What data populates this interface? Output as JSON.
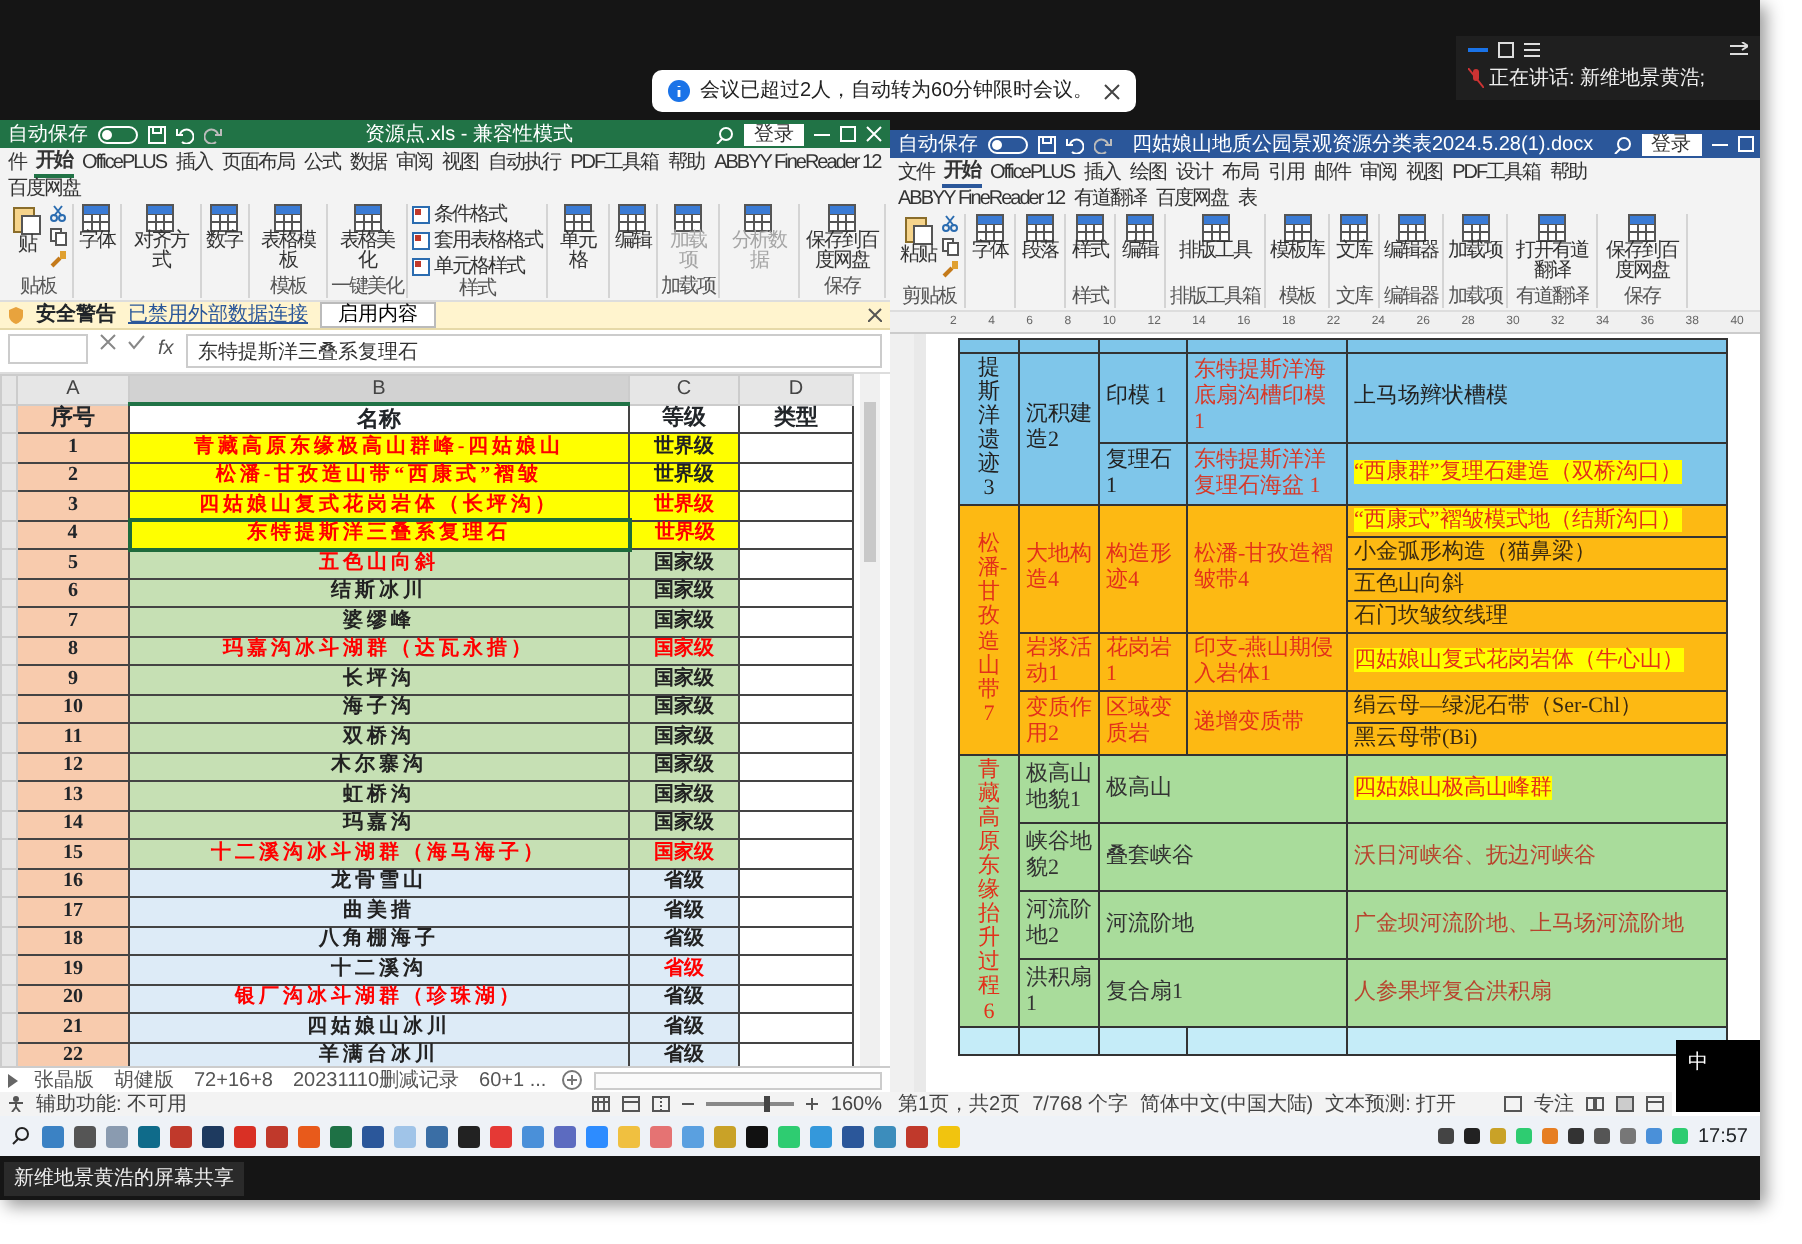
{
  "meeting": {
    "notice": "会议已超过2人，自动转为60分钟限时会议。",
    "speaker_label": "正在讲话:",
    "speaker": "新维地景黄浩;",
    "share_label": "新维地景黄浩的屏幕共享",
    "ime": "中"
  },
  "excel": {
    "autosave": "自动保存",
    "autosave_on": false,
    "title": "资源点.xls - 兼容性模式",
    "signin": "登录",
    "tabs": [
      {
        "label": "件",
        "selected": false
      },
      {
        "label": "开始",
        "selected": true
      },
      {
        "label": "OfficePLUS",
        "selected": false
      },
      {
        "label": "插入",
        "selected": false
      },
      {
        "label": "页面布局",
        "selected": false
      },
      {
        "label": "公式",
        "selected": false
      },
      {
        "label": "数据",
        "selected": false
      },
      {
        "label": "审阅",
        "selected": false
      },
      {
        "label": "视图",
        "selected": false
      },
      {
        "label": "自动执行",
        "selected": false
      },
      {
        "label": "PDF工具箱",
        "selected": false
      },
      {
        "label": "帮助",
        "selected": false
      },
      {
        "label": "ABBYY FineReader 12",
        "selected": false
      },
      {
        "label": "百度网盘",
        "selected": false
      }
    ],
    "ribbon": [
      {
        "label": "贴板",
        "buttons": [
          {
            "label": "贴",
            "kind": "paste",
            "disabled": false
          }
        ]
      },
      {
        "buttons": [
          {
            "label": "字体",
            "kind": "large",
            "disabled": false
          }
        ]
      },
      {
        "buttons": [
          {
            "label": "对齐方式",
            "kind": "large",
            "disabled": false
          }
        ]
      },
      {
        "buttons": [
          {
            "label": "数字",
            "kind": "large",
            "disabled": false
          }
        ]
      },
      {
        "label": "模板",
        "buttons": [
          {
            "label": "表格模板",
            "kind": "large",
            "disabled": false
          }
        ]
      },
      {
        "label": "一键美化",
        "buttons": [
          {
            "label": "表格美化",
            "kind": "large",
            "disabled": false
          }
        ]
      },
      {
        "label": "样式",
        "buttons": [
          {
            "label": "条件格式",
            "kind": "small",
            "disabled": false
          },
          {
            "label": "套用表格格式",
            "kind": "small",
            "disabled": false
          },
          {
            "label": "单元格样式",
            "kind": "small",
            "disabled": false
          }
        ]
      },
      {
        "buttons": [
          {
            "label": "单元格",
            "kind": "large",
            "disabled": false
          }
        ]
      },
      {
        "buttons": [
          {
            "label": "编辑",
            "kind": "large",
            "disabled": false
          }
        ]
      },
      {
        "label": "加载项",
        "buttons": [
          {
            "label": "加载项",
            "kind": "large",
            "disabled": true
          }
        ]
      },
      {
        "buttons": [
          {
            "label": "分析数据",
            "kind": "large",
            "disabled": true
          }
        ]
      },
      {
        "label": "保存",
        "buttons": [
          {
            "label": "保存到百度网盘",
            "kind": "large",
            "disabled": false
          }
        ]
      }
    ],
    "security": {
      "title": "安全警告",
      "message": "已禁用外部数据连接",
      "button": "启用内容"
    },
    "formula": {
      "fx": "fx",
      "value": "东特提斯洋三叠系复理石"
    },
    "columns": [
      {
        "label": "A",
        "selected": false
      },
      {
        "label": "B",
        "selected": true
      },
      {
        "label": "C",
        "selected": false
      },
      {
        "label": "D",
        "selected": false
      }
    ],
    "header": [
      "序号",
      "名称",
      "等级",
      "类型"
    ],
    "rows": [
      {
        "no": "1",
        "name": "青藏高原东缘极高山群峰-四姑娘山",
        "grade": "世界级",
        "kind": "world",
        "name_red": true,
        "grade_red": false,
        "selected": false
      },
      {
        "no": "2",
        "name": "松潘-甘孜造山带“西康式”褶皱",
        "grade": "世界级",
        "kind": "world",
        "name_red": true,
        "grade_red": false,
        "selected": false
      },
      {
        "no": "3",
        "name": "四姑娘山复式花岗岩体（长坪沟）",
        "grade": "世界级",
        "kind": "world",
        "name_red": true,
        "grade_red": true,
        "selected": false
      },
      {
        "no": "4",
        "name": "东特提斯洋三叠系复理石",
        "grade": "世界级",
        "kind": "world",
        "name_red": true,
        "grade_red": true,
        "selected": true
      },
      {
        "no": "5",
        "name": "五色山向斜",
        "grade": "国家级",
        "kind": "national",
        "name_red": true,
        "grade_red": false,
        "selected": false
      },
      {
        "no": "6",
        "name": "结斯冰川",
        "grade": "国家级",
        "kind": "national",
        "name_red": false,
        "grade_red": false,
        "selected": false
      },
      {
        "no": "7",
        "name": "婆缪峰",
        "grade": "国家级",
        "kind": "national",
        "name_red": false,
        "grade_red": false,
        "selected": false
      },
      {
        "no": "8",
        "name": "玛嘉沟冰斗湖群（达瓦永措）",
        "grade": "国家级",
        "kind": "national",
        "name_red": true,
        "grade_red": true,
        "selected": false
      },
      {
        "no": "9",
        "name": "长坪沟",
        "grade": "国家级",
        "kind": "national",
        "name_red": false,
        "grade_red": false,
        "selected": false
      },
      {
        "no": "10",
        "name": "海子沟",
        "grade": "国家级",
        "kind": "national",
        "name_red": false,
        "grade_red": false,
        "selected": false
      },
      {
        "no": "11",
        "name": "双桥沟",
        "grade": "国家级",
        "kind": "national",
        "name_red": false,
        "grade_red": false,
        "selected": false
      },
      {
        "no": "12",
        "name": "木尔寨沟",
        "grade": "国家级",
        "kind": "national",
        "name_red": false,
        "grade_red": false,
        "selected": false
      },
      {
        "no": "13",
        "name": "虹桥沟",
        "grade": "国家级",
        "kind": "national",
        "name_red": false,
        "grade_red": false,
        "selected": false
      },
      {
        "no": "14",
        "name": "玛嘉沟",
        "grade": "国家级",
        "kind": "national",
        "name_red": false,
        "grade_red": false,
        "selected": false
      },
      {
        "no": "15",
        "name": "十二溪沟冰斗湖群（海马海子）",
        "grade": "国家级",
        "kind": "national",
        "name_red": true,
        "grade_red": true,
        "selected": false
      },
      {
        "no": "16",
        "name": "龙骨雪山",
        "grade": "省级",
        "kind": "provincial",
        "name_red": false,
        "grade_red": false,
        "selected": false
      },
      {
        "no": "17",
        "name": "曲美措",
        "grade": "省级",
        "kind": "provincial",
        "name_red": false,
        "grade_red": false,
        "selected": false
      },
      {
        "no": "18",
        "name": "八角棚海子",
        "grade": "省级",
        "kind": "provincial",
        "name_red": false,
        "grade_red": false,
        "selected": false
      },
      {
        "no": "19",
        "name": "十二溪沟",
        "grade": "省级",
        "kind": "provincial",
        "name_red": false,
        "grade_red": true,
        "selected": false
      },
      {
        "no": "20",
        "name": "银厂沟冰斗湖群（珍珠湖）",
        "grade": "省级",
        "kind": "provincial",
        "name_red": true,
        "grade_red": false,
        "selected": false
      },
      {
        "no": "21",
        "name": "四姑娘山冰川",
        "grade": "省级",
        "kind": "provincial",
        "name_red": false,
        "grade_red": false,
        "selected": false
      },
      {
        "no": "22",
        "name": "羊满台冰川",
        "grade": "省级",
        "kind": "provincial",
        "name_red": false,
        "grade_red": false,
        "selected": false
      }
    ],
    "sheets": [
      {
        "label": "张晶版",
        "selected": false
      },
      {
        "label": "胡健版",
        "selected": false
      },
      {
        "label": "72+16+8",
        "selected": false
      },
      {
        "label": "20231110删减记录",
        "selected": false
      },
      {
        "label": "60+1 ...",
        "selected": false
      }
    ],
    "status": {
      "accessibility": "辅助功能: 不可用",
      "zoom": "160%",
      "level": 0.65
    }
  },
  "word": {
    "autosave": "自动保存",
    "autosave_on": false,
    "title": "四姑娘山地质公园景观资源分类表2024.5.28(1).docx",
    "signin": "登录",
    "tabs": [
      {
        "label": "文件",
        "selected": false
      },
      {
        "label": "开始",
        "selected": true
      },
      {
        "label": "OfficePLUS",
        "selected": false
      },
      {
        "label": "插入",
        "selected": false
      },
      {
        "label": "绘图",
        "selected": false
      },
      {
        "label": "设计",
        "selected": false
      },
      {
        "label": "布局",
        "selected": false
      },
      {
        "label": "引用",
        "selected": false
      },
      {
        "label": "邮件",
        "selected": false
      },
      {
        "label": "审阅",
        "selected": false
      },
      {
        "label": "视图",
        "selected": false
      },
      {
        "label": "PDF工具箱",
        "selected": false
      },
      {
        "label": "帮助",
        "selected": false
      },
      {
        "label": "ABBYY FineReader 12",
        "selected": false
      },
      {
        "label": "有道翻译",
        "selected": false
      },
      {
        "label": "百度网盘",
        "selected": false
      },
      {
        "label": "表",
        "selected": false
      }
    ],
    "ribbon": [
      {
        "label": "剪贴板",
        "buttons": [
          {
            "label": "粘贴",
            "kind": "paste",
            "disabled": false
          }
        ]
      },
      {
        "buttons": [
          {
            "label": "字体",
            "kind": "large",
            "disabled": false
          }
        ]
      },
      {
        "buttons": [
          {
            "label": "段落",
            "kind": "large",
            "disabled": false
          }
        ]
      },
      {
        "label": "样式",
        "buttons": [
          {
            "label": "样式",
            "kind": "large",
            "disabled": false
          }
        ]
      },
      {
        "buttons": [
          {
            "label": "编辑",
            "kind": "large",
            "disabled": false
          }
        ]
      },
      {
        "label": "排版工具箱",
        "buttons": [
          {
            "label": "排版工具",
            "kind": "large",
            "disabled": false
          }
        ]
      },
      {
        "label": "模板",
        "buttons": [
          {
            "label": "模板库",
            "kind": "large",
            "disabled": false
          }
        ]
      },
      {
        "label": "文库",
        "buttons": [
          {
            "label": "文库",
            "kind": "large",
            "disabled": false
          }
        ]
      },
      {
        "label": "编辑器",
        "buttons": [
          {
            "label": "编辑器",
            "kind": "large",
            "disabled": false
          }
        ]
      },
      {
        "label": "加载项",
        "buttons": [
          {
            "label": "加载项",
            "kind": "large",
            "disabled": false
          }
        ]
      },
      {
        "label": "有道翻译",
        "buttons": [
          {
            "label": "打开有道翻译",
            "kind": "large",
            "disabled": false
          }
        ]
      },
      {
        "label": "保存",
        "buttons": [
          {
            "label": "保存到百度网盘",
            "kind": "large",
            "disabled": false
          }
        ]
      }
    ],
    "ruler": [
      "2",
      "4",
      "6",
      "8",
      "10",
      "12",
      "14",
      "16",
      "18",
      "22",
      "24",
      "26",
      "28",
      "30",
      "32",
      "34",
      "36",
      "38",
      "40"
    ],
    "table": {
      "sections": [
        {
          "kind": "blue",
          "label": "提斯洋遗迹3",
          "groups": [
            {
              "label": "沉积建造2",
              "subgroups": [
                {
                  "type": "印模 1",
                  "example": "东特提斯洋海底扇沟槽印模 1",
                  "items": [
                    {
                      "text": "上马场辫状槽模",
                      "highlighted": false
                    }
                  ]
                },
                {
                  "type": "复理石 1",
                  "example": "东特提斯洋洋复理石海盆 1",
                  "items": [
                    {
                      "text": "“西康群”复理石建造（双桥沟口）",
                      "highlighted": true
                    }
                  ]
                }
              ]
            }
          ]
        },
        {
          "kind": "orange",
          "label": "松潘-甘孜造山带7",
          "groups": [
            {
              "label": "大地构造4",
              "subgroups": [
                {
                  "type": "构造形迹4",
                  "example": "松潘-甘孜造褶皱带4",
                  "items": [
                    {
                      "text": "“西康式”褶皱模式地（结斯沟口）",
                      "highlighted": true
                    },
                    {
                      "text": "小金弧形构造（猫鼻梁）",
                      "highlighted": false
                    },
                    {
                      "text": "五色山向斜",
                      "highlighted": false
                    },
                    {
                      "text": "石门坎皱纹线理",
                      "highlighted": false
                    }
                  ]
                }
              ]
            },
            {
              "label": "岩浆活动1",
              "subgroups": [
                {
                  "type": "花岗岩1",
                  "example": "印支-燕山期侵入岩体1",
                  "items": [
                    {
                      "text": "四姑娘山复式花岗岩体（牛心山）",
                      "highlighted": true
                    }
                  ]
                }
              ]
            },
            {
              "label": "变质作用2",
              "subgroups": [
                {
                  "type": "区域变质岩",
                  "example": "递增变质带",
                  "items": [
                    {
                      "text": "绢云母—绿泥石带（Ser-Chl）",
                      "highlighted": false
                    },
                    {
                      "text": "黑云母带(Bi)",
                      "highlighted": false
                    }
                  ]
                }
              ]
            }
          ]
        },
        {
          "kind": "green",
          "label": "青藏高原东缘抬升过程6",
          "groups": [
            {
              "label": "极高山地貌1",
              "subgroups": [
                {
                  "type": "极高山",
                  "items": [
                    {
                      "text": "四姑娘山极高山峰群",
                      "highlighted": true
                    }
                  ]
                }
              ]
            },
            {
              "label": "峡谷地貌2",
              "subgroups": [
                {
                  "type": "叠套峡谷",
                  "items": [
                    {
                      "text": "沃日河峡谷、抚边河峡谷",
                      "highlighted": false
                    }
                  ]
                }
              ]
            },
            {
              "label": "河流阶地2",
              "subgroups": [
                {
                  "type": "河流阶地",
                  "items": [
                    {
                      "text": "广金坝河流阶地、上马场河流阶地",
                      "highlighted": false
                    }
                  ]
                }
              ]
            },
            {
              "label": "洪积扇1",
              "subgroups": [
                {
                  "type": "复合扇1",
                  "items": [
                    {
                      "text": "人参果坪复合洪积扇",
                      "highlighted": false
                    }
                  ]
                }
              ]
            }
          ]
        }
      ]
    },
    "status": [
      "第1页，共2页",
      "7/768 个字",
      "简体中文(中国大陆)",
      "文本预测: 打开"
    ],
    "focus": "专注"
  },
  "taskbar": {
    "time": "17:57"
  }
}
